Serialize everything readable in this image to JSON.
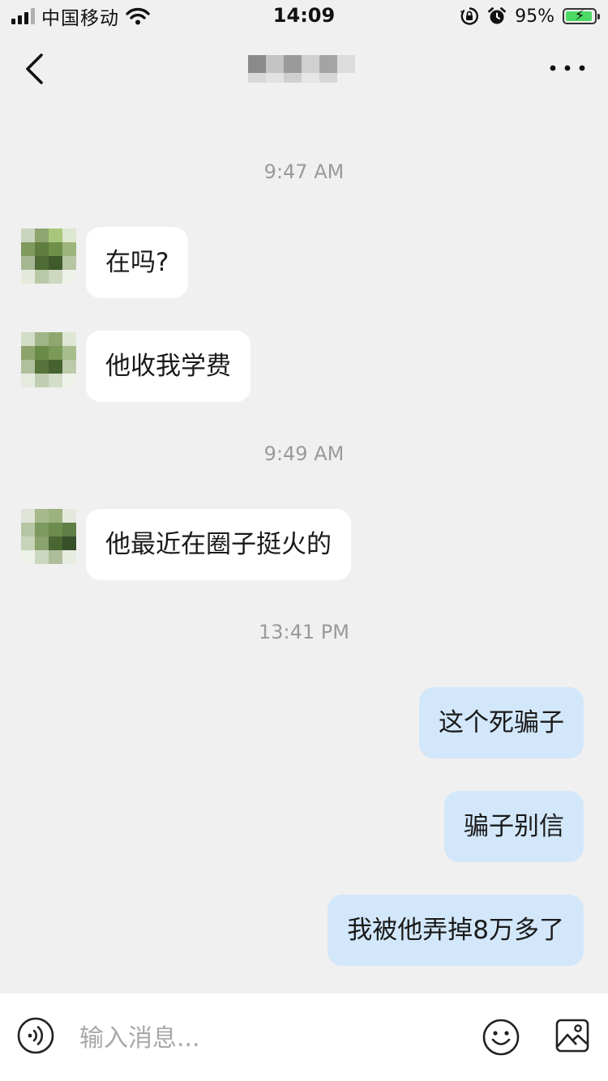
{
  "status_bar": {
    "carrier": "中国移动",
    "time": "14:09",
    "battery_percent": "95%",
    "battery_level": 0.95,
    "signal_bars": 3,
    "icons": [
      "signal-icon",
      "wifi-icon",
      "orientation-lock-icon",
      "alarm-icon",
      "battery-charging-icon"
    ]
  },
  "nav": {
    "back_icon": "chevron-left-icon",
    "title": "",
    "title_obscured": true,
    "more_icon": "more-dots-icon"
  },
  "messages": {
    "t1": "9:47 AM",
    "m1": "在吗?",
    "m2": "他收我学费",
    "t2": "9:49 AM",
    "m3": "他最近在圈子挺火的",
    "t3": "13:41 PM",
    "m4": "这个死骗子",
    "m5": "骗子别信",
    "m6": "我被他弄掉8万多了"
  },
  "input_bar": {
    "placeholder": "输入消息...",
    "value": "",
    "icons": [
      "voice-icon",
      "emoji-icon",
      "image-icon"
    ]
  },
  "colors": {
    "background": "#f0f0f0",
    "incoming_bubble": "#ffffff",
    "outgoing_bubble": "#d3e7fa",
    "timestamp_text": "#9a9a9a",
    "battery_fill": "#4cd964"
  }
}
